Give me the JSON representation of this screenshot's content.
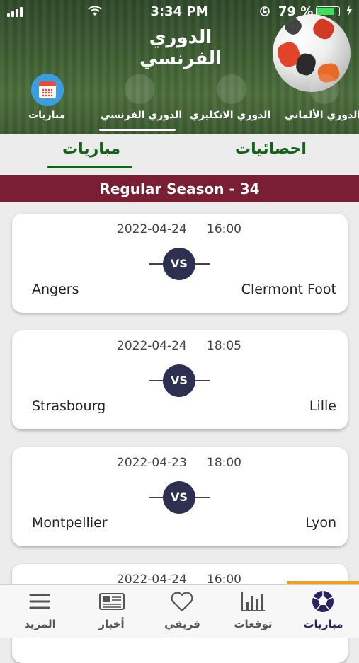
{
  "status_bar": {
    "time": "3:34 PM",
    "battery": "79 %"
  },
  "header": {
    "title": "الدوري الفرنسي"
  },
  "league_tabs": [
    {
      "label": "الدوري الألماني"
    },
    {
      "label": "الدوري الانكليزي"
    },
    {
      "label": "الدوري الفرنسي"
    },
    {
      "label": "مباريات"
    }
  ],
  "segments": {
    "stats": "احصائيات",
    "matches": "مباريات"
  },
  "round": "Regular Season - 34",
  "matches": [
    {
      "date": "2022-04-24",
      "time": "16:00",
      "home": "Clermont Foot",
      "away": "Angers"
    },
    {
      "date": "2022-04-24",
      "time": "18:05",
      "home": "Lille",
      "away": "Strasbourg"
    },
    {
      "date": "2022-04-23",
      "time": "18:00",
      "home": "Lyon",
      "away": "Montpellier"
    },
    {
      "date": "2022-04-24",
      "time": "16:00",
      "home": "",
      "away": ""
    }
  ],
  "vs_label": "VS",
  "bottom_tabs": [
    {
      "label": "مباريات",
      "icon": "soccer-ball-icon"
    },
    {
      "label": "توقعات",
      "icon": "bar-chart-icon"
    },
    {
      "label": "فريقي",
      "icon": "heart-icon"
    },
    {
      "label": "أخبار",
      "icon": "newspaper-icon"
    },
    {
      "label": "المزيد",
      "icon": "menu-icon"
    }
  ],
  "colors": {
    "accent_green": "#126316",
    "round_bar": "#7a1f33",
    "vs_badge": "#2d3050",
    "active_tab": "#2c2460",
    "highlight": "#e8a228"
  }
}
